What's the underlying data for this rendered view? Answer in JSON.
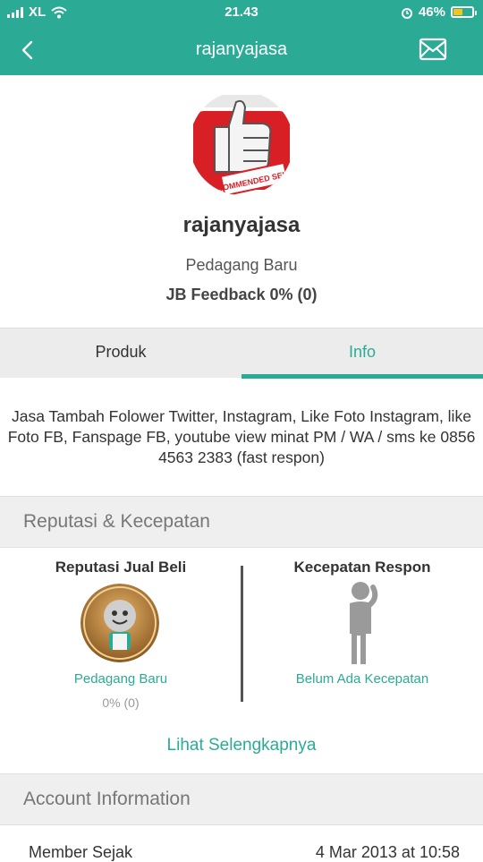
{
  "status_bar": {
    "carrier": "XL",
    "time": "21.43",
    "battery": "46%"
  },
  "header": {
    "title": "rajanyajasa"
  },
  "profile": {
    "avatar_label": "RECOMMENDED SELLER",
    "username": "rajanyajasa",
    "subtitle": "Pedagang Baru",
    "feedback": "JB Feedback 0% (0)"
  },
  "tabs": [
    {
      "label": "Produk",
      "active": false
    },
    {
      "label": "Info",
      "active": true
    }
  ],
  "description": "Jasa Tambah Folower Twitter, Instagram, Like Foto Instagram, like Foto FB, Fanspage FB, youtube view minat PM / WA / sms ke 0856 4563 2383 (fast respon)",
  "reputation": {
    "section_title": "Reputasi & Kecepatan",
    "left": {
      "title": "Reputasi Jual Beli",
      "label": "Pedagang Baru",
      "sub": "0% (0)"
    },
    "right": {
      "title": "Kecepatan Respon",
      "label": "Belum Ada Kecepatan"
    },
    "more_link": "Lihat Selengkapnya"
  },
  "account": {
    "section_title": "Account Information",
    "rows": [
      {
        "key": "Member Sejak",
        "value": "4 Mar 2013 at 10:58"
      }
    ]
  },
  "colors": {
    "accent": "#2bab96"
  }
}
